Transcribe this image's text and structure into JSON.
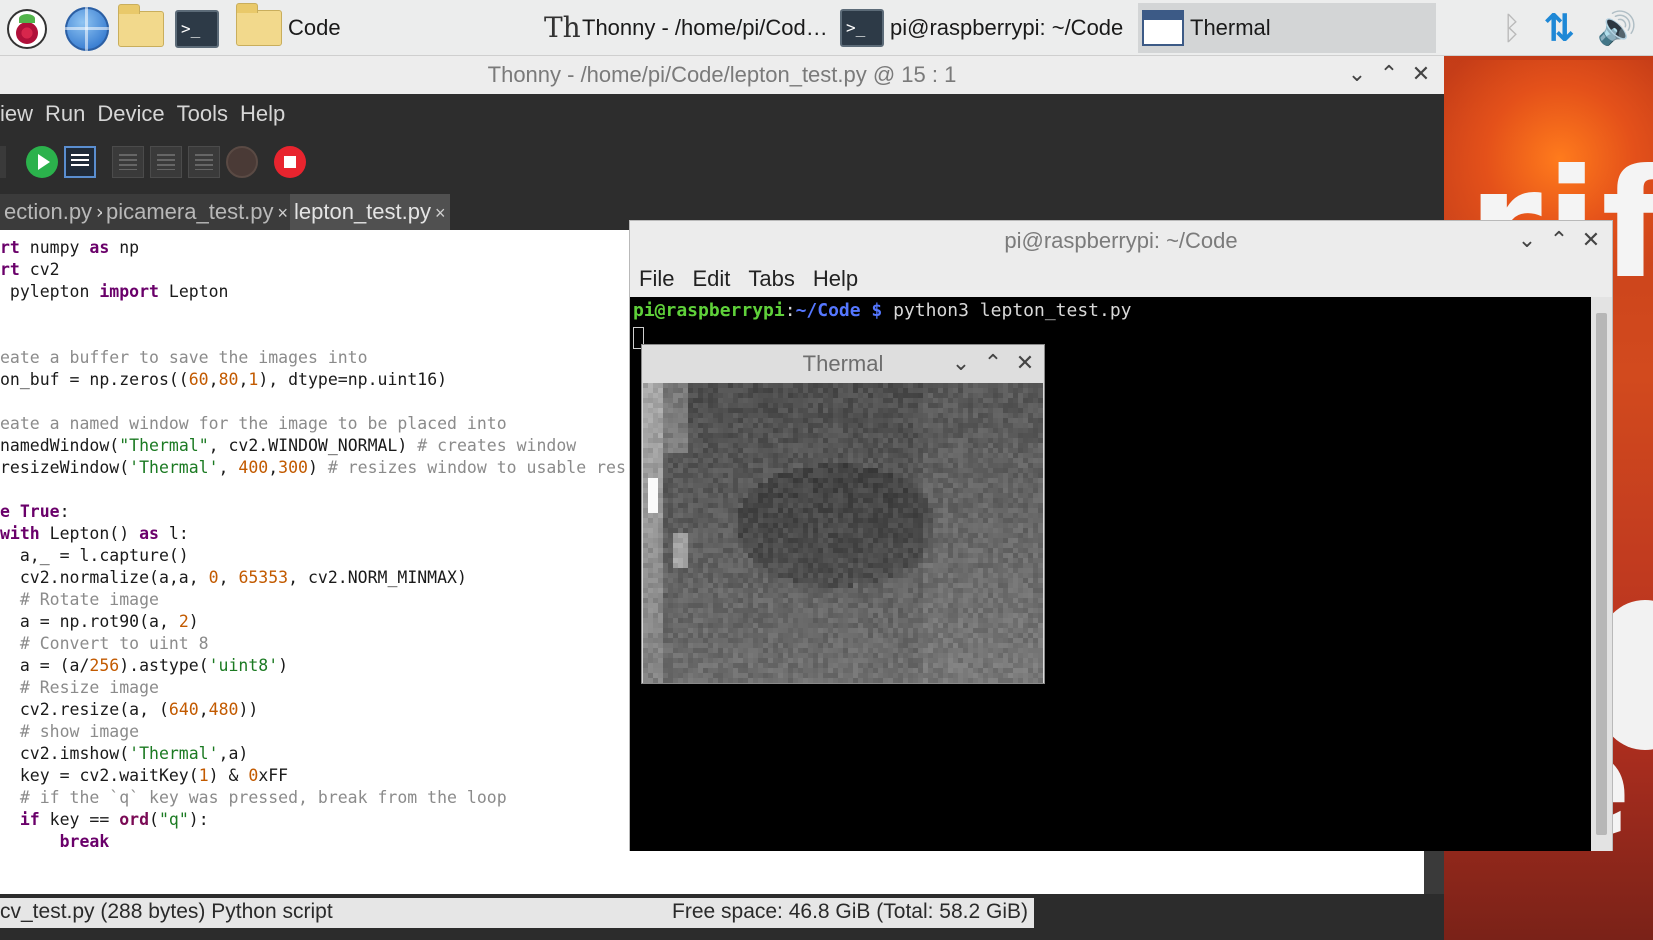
{
  "taskbar": {
    "launchers": [
      {
        "name": "raspberry-menu",
        "icon": "raspberry-pi-icon"
      },
      {
        "name": "browser",
        "icon": "globe-icon"
      },
      {
        "name": "file-manager",
        "icon": "folder-icon"
      },
      {
        "name": "terminal",
        "icon": "terminal-icon"
      }
    ],
    "tasks": [
      {
        "label": "Code",
        "icon": "folder-icon",
        "active": false
      },
      {
        "label": "Thonny  -  /home/pi/Code...",
        "icon": "thonny-icon",
        "active": false
      },
      {
        "label": "pi@raspberrypi: ~/Code",
        "icon": "terminal-icon",
        "active": false
      },
      {
        "label": "Thermal",
        "icon": "window-icon",
        "active": true
      }
    ],
    "tray": {
      "bluetooth": "bluetooth-icon",
      "network": "network-icon",
      "volume": "volume-icon"
    }
  },
  "thonny": {
    "title": "Thonny  -  /home/pi/Code/lepton_test.py  @  15 : 1",
    "menu": [
      "iew",
      "Run",
      "Device",
      "Tools",
      "Help"
    ],
    "tabs": [
      {
        "label": "ection.py",
        "close": "×",
        "active": false
      },
      {
        "label": "picamera_test.py",
        "close": "×",
        "active": false
      },
      {
        "label": "lepton_test.py",
        "close": "×",
        "active": true
      }
    ],
    "status_left": "cv_test.py (288 bytes) Python script",
    "status_right": "Free space: 46.8 GiB (Total: 58.2 GiB)"
  },
  "editor": {
    "lines": [
      [
        [
          "kw",
          "rt"
        ],
        [
          "t",
          " numpy "
        ],
        [
          "kw",
          "as"
        ],
        [
          "t",
          " np"
        ]
      ],
      [
        [
          "kw",
          "rt"
        ],
        [
          "t",
          " cv2"
        ]
      ],
      [
        [
          "t",
          " pylepton "
        ],
        [
          "kw",
          "import"
        ],
        [
          "t",
          " Lepton"
        ]
      ],
      [],
      [],
      [
        [
          "cmt",
          "eate a buffer to save the images into"
        ]
      ],
      [
        [
          "t",
          "on_buf = np.zeros(("
        ],
        [
          "num",
          "60"
        ],
        [
          "t",
          ","
        ],
        [
          "num",
          "80"
        ],
        [
          "t",
          ","
        ],
        [
          "num",
          "1"
        ],
        [
          "t",
          "), dtype=np.uint16)"
        ]
      ],
      [],
      [
        [
          "cmt",
          "eate a named window for the image to be placed into"
        ]
      ],
      [
        [
          "t",
          "namedWindow("
        ],
        [
          "str",
          "\"Thermal\""
        ],
        [
          "t",
          ", cv2.WINDOW_NORMAL) "
        ],
        [
          "cmt",
          "# creates window"
        ]
      ],
      [
        [
          "t",
          "resizeWindow("
        ],
        [
          "str",
          "'Thermal'"
        ],
        [
          "t",
          ", "
        ],
        [
          "num",
          "400"
        ],
        [
          "t",
          ","
        ],
        [
          "num",
          "300"
        ],
        [
          "t",
          ") "
        ],
        [
          "cmt",
          "# resizes window to usable res"
        ]
      ],
      [],
      [
        [
          "kw",
          "e True"
        ],
        [
          "t",
          ":"
        ]
      ],
      [
        [
          "kw",
          "with"
        ],
        [
          "t",
          " Lepton() "
        ],
        [
          "kw",
          "as"
        ],
        [
          "t",
          " l:"
        ]
      ],
      [
        [
          "t",
          "  a,_ = l.capture()"
        ]
      ],
      [
        [
          "t",
          "  cv2.normalize(a,a, "
        ],
        [
          "num",
          "0"
        ],
        [
          "t",
          ", "
        ],
        [
          "num",
          "65353"
        ],
        [
          "t",
          ", cv2.NORM_MINMAX)"
        ]
      ],
      [
        [
          "cmt",
          "  # Rotate image"
        ]
      ],
      [
        [
          "t",
          "  a = np.rot90(a, "
        ],
        [
          "num",
          "2"
        ],
        [
          "t",
          ")"
        ]
      ],
      [
        [
          "cmt",
          "  # Convert to uint 8"
        ]
      ],
      [
        [
          "t",
          "  a = (a/"
        ],
        [
          "num",
          "256"
        ],
        [
          "t",
          ").astype("
        ],
        [
          "str",
          "'uint8'"
        ],
        [
          "t",
          ")"
        ]
      ],
      [
        [
          "cmt",
          "  # Resize image"
        ]
      ],
      [
        [
          "t",
          "  cv2.resize(a, ("
        ],
        [
          "num",
          "640"
        ],
        [
          "t",
          ","
        ],
        [
          "num",
          "480"
        ],
        [
          "t",
          "))"
        ]
      ],
      [
        [
          "cmt",
          "  # show image"
        ]
      ],
      [
        [
          "t",
          "  cv2.imshow("
        ],
        [
          "str",
          "'Thermal'"
        ],
        [
          "t",
          ",a)"
        ]
      ],
      [
        [
          "t",
          "  key = cv2.waitKey("
        ],
        [
          "num",
          "1"
        ],
        [
          "t",
          ") & "
        ],
        [
          "num",
          "0"
        ],
        [
          "t",
          "xFF"
        ]
      ],
      [
        [
          "cmt",
          "  # if the `q` key was pressed, break from the loop"
        ]
      ],
      [
        [
          "t",
          "  "
        ],
        [
          "kw",
          "if"
        ],
        [
          "t",
          " key == "
        ],
        [
          "kw2",
          "ord"
        ],
        [
          "t",
          "("
        ],
        [
          "str",
          "\"q\""
        ],
        [
          "t",
          "):"
        ]
      ],
      [
        [
          "t",
          "      "
        ],
        [
          "kw",
          "break"
        ]
      ]
    ]
  },
  "terminal": {
    "title": "pi@raspberrypi: ~/Code",
    "menu": [
      "File",
      "Edit",
      "Tabs",
      "Help"
    ],
    "prompt_user": "pi@raspberrypi",
    "prompt_sep": ":",
    "prompt_path": "~/Code",
    "prompt_symbol": " $ ",
    "command": "python3 lepton_test.py"
  },
  "thermal": {
    "title": "Thermal"
  },
  "window_controls": {
    "minimize": "⌄",
    "maximize": "⌃",
    "close": "✕"
  },
  "wallpaper": {
    "text_top": "rif",
    "text_bottom": "e"
  },
  "colors": {
    "accent": "#1e88d6",
    "run_green": "#2bb24c",
    "stop_red": "#e8242e",
    "prompt_green": "#5fd13a",
    "prompt_blue": "#5577ff"
  }
}
